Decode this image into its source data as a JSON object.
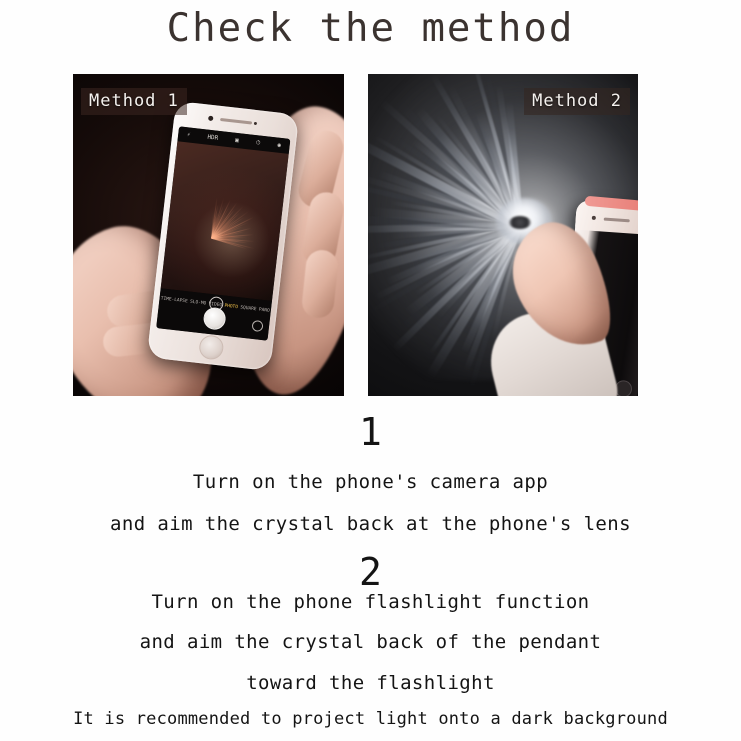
{
  "title": "Check the method",
  "panels": [
    {
      "label": "Method 1",
      "icon": "phone-camera-photo",
      "camera_ui": {
        "top_icons": [
          "flash-icon",
          "hdr-icon",
          "filters-icon",
          "timer-icon"
        ],
        "modes": [
          "TIME-LAPSE",
          "SLO-MO",
          "VIDEO",
          "PHOTO",
          "SQUARE",
          "PANO"
        ],
        "active_mode": "PHOTO",
        "shutter": "shutter-button",
        "flip": "flip-camera-icon"
      }
    },
    {
      "label": "Method 2",
      "icon": "phone-flashlight-projection-photo"
    }
  ],
  "steps": [
    {
      "number": "1",
      "lines": [
        "Turn on the phone's camera app",
        "and aim the crystal back at the phone's lens"
      ]
    },
    {
      "number": "2",
      "lines": [
        "Turn on the phone flashlight function",
        "and aim the crystal back of the pendant",
        "toward the flashlight"
      ]
    }
  ],
  "footnote": "It is recommended to project light onto a dark background",
  "colors": {
    "background": "#fefefe",
    "title": "#3b3330",
    "body_text": "#141414",
    "label_text": "#f4f1ee"
  }
}
